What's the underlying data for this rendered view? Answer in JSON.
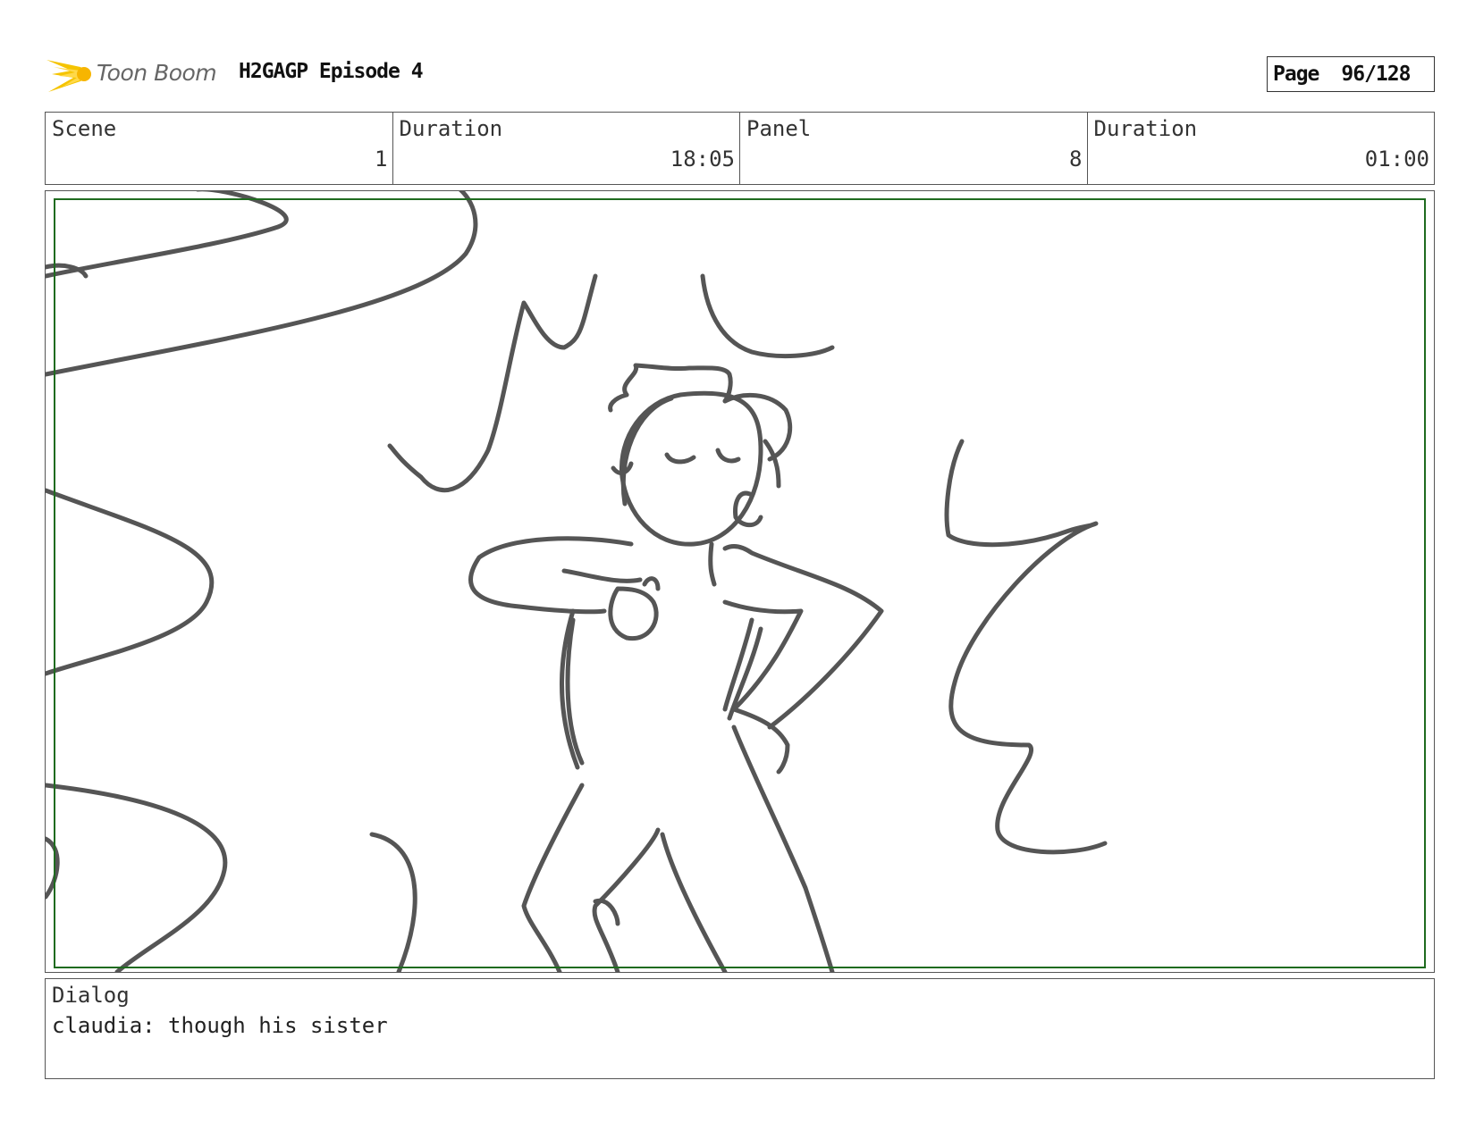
{
  "header": {
    "logo_text": "Toon Boom",
    "title": "H2GAGP Episode 4",
    "page_label": "Page",
    "page_value": "96/128"
  },
  "info": {
    "scene_label": "Scene",
    "scene_value": "1",
    "duration_label": "Duration",
    "duration_value": "18:05",
    "panel_label": "Panel",
    "panel_value": "8",
    "panel_duration_label": "Duration",
    "panel_duration_value": "01:00"
  },
  "dialog": {
    "label": "Dialog",
    "text": "claudia: though his sister"
  },
  "colors": {
    "frame_green": "#1f6b1f",
    "sketch_gray": "#555555",
    "logo_yellow": "#f5c400"
  }
}
